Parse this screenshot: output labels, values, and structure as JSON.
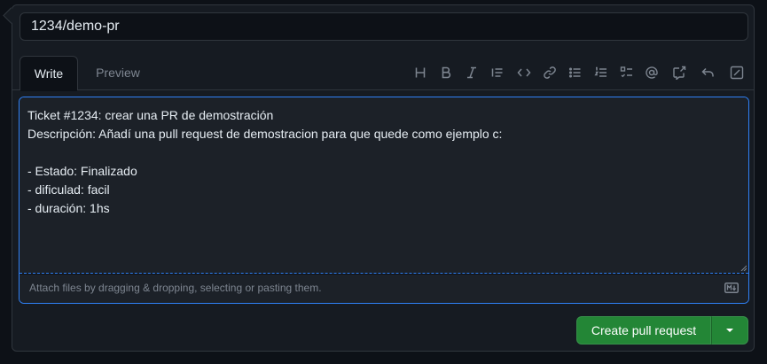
{
  "pr_form": {
    "title_value": "1234/demo-pr",
    "tabs": [
      {
        "label": "Write",
        "active": true
      },
      {
        "label": "Preview",
        "active": false
      }
    ],
    "toolbar_icons": [
      "heading-icon",
      "bold-icon",
      "italic-icon",
      "quote-icon",
      "code-icon",
      "link-icon",
      "unordered-list-icon",
      "ordered-list-icon",
      "task-list-icon",
      "mention-icon",
      "cross-reference-icon",
      "reply-icon",
      "fullscreen-icon"
    ],
    "body_lines": [
      "Ticket #1234: crear una PR de demostración",
      "Descripción: Añadí una pull request de demostracion para que quede como ejemplo c:",
      "",
      "- Estado: Finalizado",
      "- dificulad: facil",
      "- duración: 1hs"
    ],
    "attach_hint": "Attach files by dragging & dropping, selecting or pasting them.",
    "submit_label": "Create pull request"
  },
  "colors": {
    "background": "#0d1117",
    "panel": "#161b22",
    "border": "#30363d",
    "focus": "#2f81f7",
    "primary_button": "#238636",
    "muted_text": "#7d8590",
    "text": "#e6edf3"
  }
}
